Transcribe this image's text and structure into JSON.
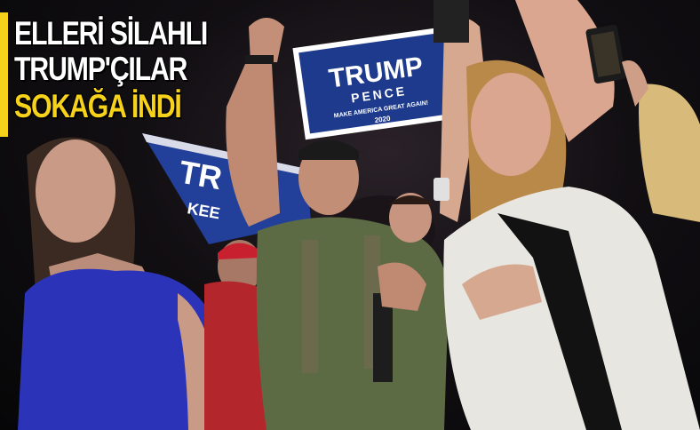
{
  "headline": {
    "line1": "ELLERİ SİLAHLI",
    "line2": "TRUMP'ÇILAR",
    "line3": "SOKAĞA İNDİ"
  },
  "sign": {
    "name1": "TRUMP",
    "name2": "PENCE",
    "slogan": "MAKE AMERICA GREAT AGAIN!",
    "year": "2020"
  },
  "banner": {
    "text": "TR",
    "text2": "KEE"
  },
  "colors": {
    "accent_yellow": "#f6d21a",
    "sign_blue": "#1d3a8c",
    "sign_red": "#c8202f",
    "shirt_blue": "#2b33b8",
    "shirt_olive": "#5d6b45",
    "shirt_white": "#e8e6e0"
  }
}
